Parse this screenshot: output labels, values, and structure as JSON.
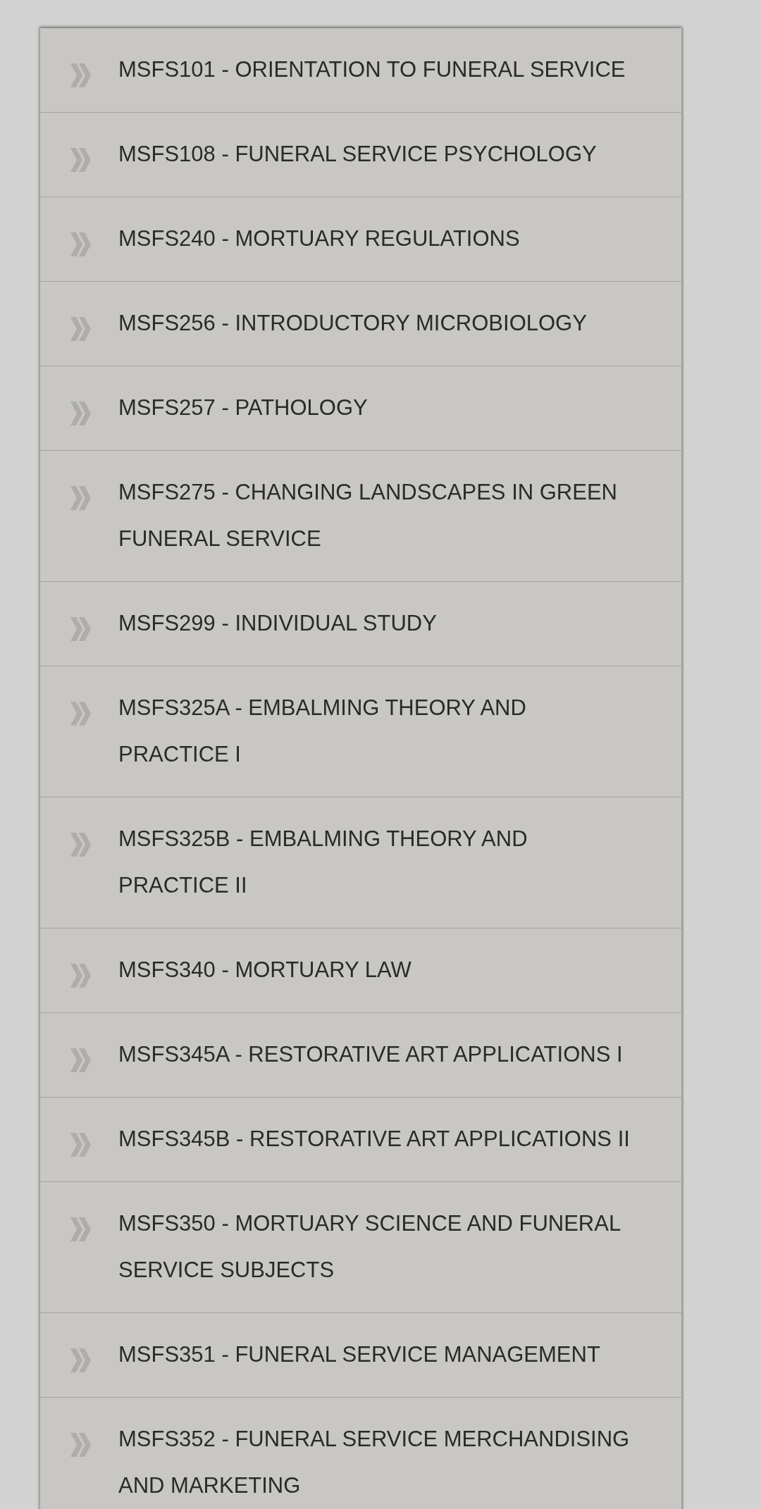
{
  "courses": [
    {
      "label": "MSFS101 - ORIENTATION TO FUNERAL SERVICE"
    },
    {
      "label": "MSFS108 - FUNERAL SERVICE PSYCHOLOGY"
    },
    {
      "label": "MSFS240 - MORTUARY REGULATIONS"
    },
    {
      "label": "MSFS256 - INTRODUCTORY MICROBIOLOGY"
    },
    {
      "label": "MSFS257 - PATHOLOGY"
    },
    {
      "label": "MSFS275 - CHANGING LANDSCAPES IN GREEN FUNERAL SERVICE"
    },
    {
      "label": "MSFS299 - INDIVIDUAL STUDY"
    },
    {
      "label": "MSFS325A - EMBALMING THEORY AND PRACTICE I"
    },
    {
      "label": "MSFS325B - EMBALMING THEORY AND PRACTICE II"
    },
    {
      "label": "MSFS340 - MORTUARY LAW"
    },
    {
      "label": "MSFS345A - RESTORATIVE ART APPLICATIONS I"
    },
    {
      "label": "MSFS345B - RESTORATIVE ART APPLICATIONS II"
    },
    {
      "label": "MSFS350 - MORTUARY SCIENCE AND FUNERAL SERVICE SUBJECTS"
    },
    {
      "label": "MSFS351 - FUNERAL SERVICE MANAGEMENT"
    },
    {
      "label": "MSFS352 - FUNERAL SERVICE MERCHANDISING AND MARKETING"
    }
  ]
}
